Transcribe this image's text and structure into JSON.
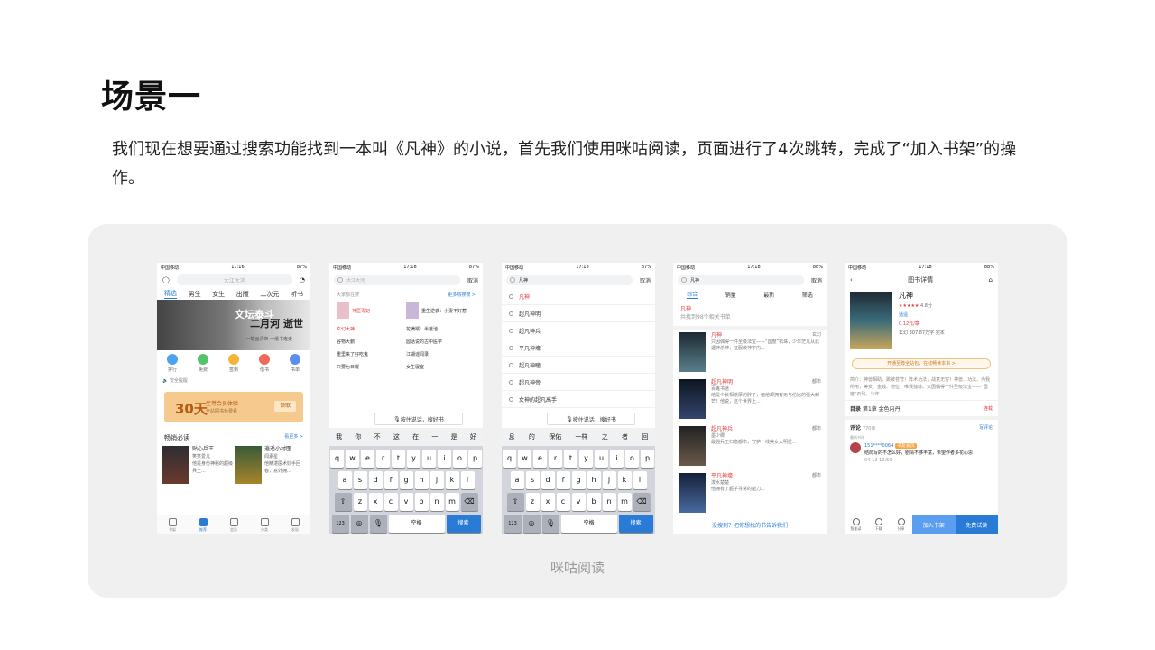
{
  "slide": {
    "title": "场景一",
    "description": "我们现在想要通过搜索功能找到一本叫《凡神》的小说，首先我们使用咪咕阅读，页面进行了4次跳转，完成了“加入书架”的操作。",
    "caption": "咪咕阅读"
  },
  "status_bar": {
    "carrier": "中国移动",
    "time": "17:16",
    "time2": "17:18",
    "battery": "87%",
    "battery2": "88%"
  },
  "home": {
    "search_placeholder": "大江大河",
    "tabs": [
      "精选",
      "男生",
      "女生",
      "出版",
      "二次元",
      "听书"
    ],
    "banner_line1": "文坛泰斗",
    "banner_line2": "二月河 逝世",
    "banner_line3": "一笔画清帝 一纸书雍史",
    "icons": [
      "排行",
      "免费",
      "签到",
      "借书",
      "书单"
    ],
    "notice": "安全提醒",
    "vip_days": "30天",
    "vip_title": "至尊会员体验",
    "vip_sub": "全站图书免费看",
    "vip_btn": "领取",
    "section_title": "畅销必读",
    "section_more": "看更多 >",
    "book1_title": "贴心兵王",
    "book1_author": "笑笑爱儿",
    "book1_desc": "他是身份神秘的超级兵王...",
    "book2_title": "逍遥小村医",
    "book2_author": "闻素星",
    "book2_desc": "他精湛医术妙手回春，意外拥...",
    "nav": [
      "书架",
      "推荐",
      "会员",
      "分类",
      "发现"
    ]
  },
  "search": {
    "placeholder": "大江大河",
    "cancel": "取消",
    "hot_title": "大家都在搜",
    "hot_more": "更多热搜榜 >",
    "featured1": "神医毒妃",
    "featured2": "重生逆袭：小妻不好惹",
    "items": [
      "玄幻大神",
      "花满蹊：半莲池",
      "谷物大鹏",
      "圆话说的古中医学",
      "重里来了好吃鬼",
      "江湖谣闻录",
      "只要七日曜",
      "女生寝室"
    ],
    "voice": "按住说话，搜好书",
    "candidates": [
      "我",
      "你",
      "不",
      "这",
      "在",
      "一",
      "是",
      "好"
    ],
    "row1": [
      "q",
      "w",
      "e",
      "r",
      "t",
      "y",
      "u",
      "i",
      "o",
      "p"
    ],
    "row2": [
      "a",
      "s",
      "d",
      "f",
      "g",
      "h",
      "j",
      "k",
      "l"
    ],
    "row3": [
      "z",
      "x",
      "c",
      "v",
      "b",
      "n",
      "m"
    ],
    "num": "123",
    "space": "空格",
    "go": "搜索"
  },
  "suggest": {
    "query": "凡神",
    "cancel": "取消",
    "items": [
      "凡神",
      "超凡神明",
      "超凡神兵",
      "平凡神壕",
      "超凡神瞳",
      "超凡神帝",
      "女神的超凡高手"
    ],
    "candidates": [
      "息",
      "的",
      "保佑",
      "一样",
      "之",
      "者",
      "回"
    ]
  },
  "results": {
    "query": "凡神",
    "cancel": "取消",
    "tabs": [
      "综合",
      "销量",
      "最新",
      "筛选"
    ],
    "info_title": "凡神",
    "info_sub": "共找到98个相关书单",
    "items": [
      {
        "title": "凡神",
        "author": "",
        "tag": "玄幻",
        "desc": "只因偶得一件圣级法宝——“国度”石珠，少年茫凡从此遇神杀神，征服教神宇内..."
      },
      {
        "title": "超凡神明",
        "author": "百鬼书迷",
        "tag": "都市",
        "desc": "他是个长相憨厚的胖子，但他却拥有无与伦比的强大刺芒！他说，这个世界上..."
      },
      {
        "title": "超凡神兵",
        "author": "墨少卿",
        "tag": "都市",
        "desc": "最强兵王归隐都市，守护一线美女大明星..."
      },
      {
        "title": "平凡神壕",
        "author": "泼水楚楚",
        "tag": "都市",
        "desc": "他拥有了超乎寻常的能力..."
      }
    ],
    "footer": "没搜到？把你想找的书告诉我们"
  },
  "detail": {
    "title": "图书详情",
    "book": "凡神",
    "rating": "4.8分",
    "author": "逍遥",
    "price": "0.12元/章",
    "genre": "玄幻",
    "words": "307.87万字",
    "status": "完本",
    "vip_btn": "开通至尊全站包，在线畅读本书 >",
    "intro": "简介：神兽相助，跳破苍穹！阵术功法，战意无穷！神兽、功法、为我所用，美女、金钱、地位，唯我独尊。只因偶得一件圣级法宝——“国度”石珠，少年...",
    "toc_label": "目录",
    "toc_chapter": "第1章 金色内丹",
    "toc_tag": "连载",
    "comment_label": "评论",
    "comment_count": "770条",
    "write_comment": "写评论",
    "latest": "最新书评",
    "user": "151****0064",
    "user_badge": "书友会员",
    "comment_text": "结局写的不怎么好，剧情不够丰富，希望作者多花心思",
    "comment_date": "04-12 10:59",
    "bar": [
      "智能读",
      "下载",
      "分享"
    ],
    "add_shelf": "加入书架",
    "free_trial": "免费试读"
  }
}
